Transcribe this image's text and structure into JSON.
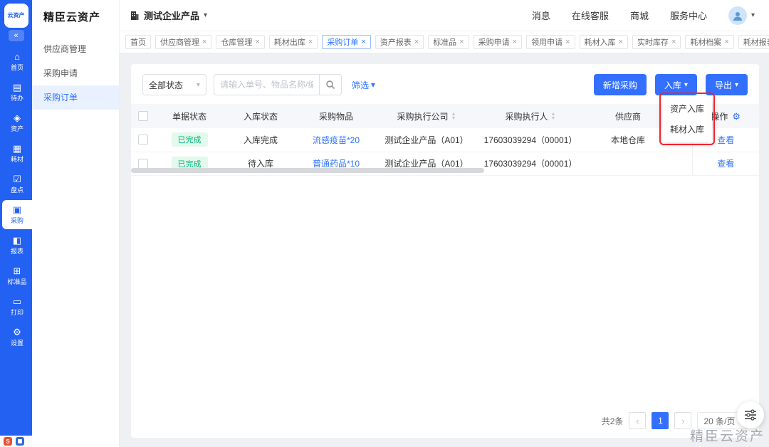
{
  "icons": {
    "collapse": "«",
    "caret_down": "▾",
    "close": "×",
    "more": "···",
    "gear": "⚙",
    "sort_up": "▲",
    "sort_down": "▼",
    "prev": "‹",
    "next": "›"
  },
  "rail": {
    "logo": "云资产",
    "items": [
      {
        "label": "首页",
        "glyph": "⌂"
      },
      {
        "label": "待办",
        "glyph": "▤"
      },
      {
        "label": "资产",
        "glyph": "◈"
      },
      {
        "label": "耗材",
        "glyph": "▦"
      },
      {
        "label": "盘点",
        "glyph": "☑"
      },
      {
        "label": "采购",
        "glyph": "▣"
      },
      {
        "label": "报表",
        "glyph": "◧"
      },
      {
        "label": "标准品",
        "glyph": "⊞"
      },
      {
        "label": "打印",
        "glyph": "▭"
      },
      {
        "label": "设置",
        "glyph": "⚙"
      }
    ]
  },
  "sidebar": {
    "title": "精臣云资产",
    "items": [
      {
        "label": "供应商管理"
      },
      {
        "label": "采购申请"
      },
      {
        "label": "采购订单"
      }
    ]
  },
  "header": {
    "company": "测试企业产品",
    "nav": [
      {
        "label": "消息"
      },
      {
        "label": "在线客服"
      },
      {
        "label": "商城"
      },
      {
        "label": "服务中心"
      }
    ]
  },
  "tabs": [
    {
      "label": "首页"
    },
    {
      "label": "供应商管理"
    },
    {
      "label": "仓库管理"
    },
    {
      "label": "耗材出库"
    },
    {
      "label": "采购订单"
    },
    {
      "label": "资产报表"
    },
    {
      "label": "标准品"
    },
    {
      "label": "采购申请"
    },
    {
      "label": "领用申请"
    },
    {
      "label": "耗材入库"
    },
    {
      "label": "实时库存"
    },
    {
      "label": "耗材档案"
    },
    {
      "label": "耗材报表"
    }
  ],
  "toolbar": {
    "status_filter": "全部状态",
    "search_placeholder": "请输入单号、物品名称/编码",
    "filter_label": "筛选",
    "add_button": "新增采购",
    "inbound_button": "入库",
    "export_button": "导出"
  },
  "inbound_menu": {
    "items": [
      {
        "label": "资产入库"
      },
      {
        "label": "耗材入库"
      }
    ]
  },
  "table": {
    "columns": [
      "单据状态",
      "入库状态",
      "采购物品",
      "采购执行公司",
      "采购执行人",
      "供应商",
      "操作"
    ],
    "rows": [
      {
        "status": "已完成",
        "inbound": "入库完成",
        "item": "流感疫苗*20",
        "company": "测试企业产品（A01）",
        "executor": "17603039294（00001）",
        "supplier": "本地仓库",
        "action": "查看"
      },
      {
        "status": "已完成",
        "inbound": "待入库",
        "item": "普通药品*10",
        "company": "测试企业产品（A01）",
        "executor": "17603039294（00001）",
        "supplier": "",
        "action": "查看"
      }
    ]
  },
  "pagination": {
    "total": "共2条",
    "page": "1",
    "page_size": "20 条/页"
  },
  "watermark": "精臣云资产",
  "taskbar": {
    "icon1": "S"
  },
  "colors": {
    "rail_blue": "#2361f2",
    "primary_blue": "#3370ff",
    "link_blue": "#2e74ff",
    "badge_green": "#00b578",
    "highlight_red": "#f5222d"
  }
}
